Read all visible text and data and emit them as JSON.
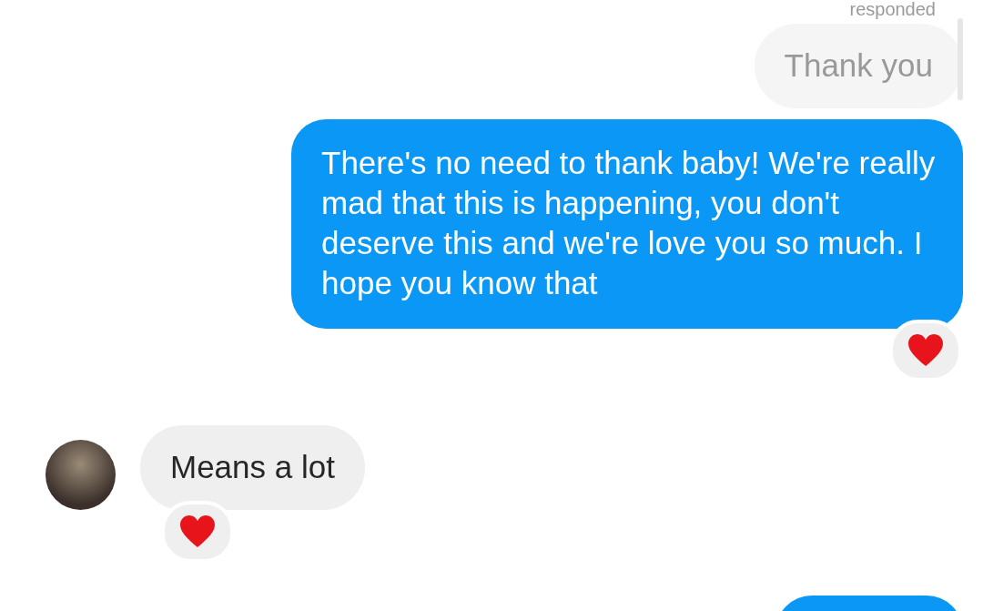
{
  "status_label": "responded",
  "messages": [
    {
      "kind": "faded",
      "text": "Thank you",
      "reacted": false
    },
    {
      "kind": "sent",
      "text": "There's no need to thank baby! We're really mad that this is happening, you don't deserve this and we're love you so much. I hope you know that",
      "reacted": true
    },
    {
      "kind": "received",
      "text": "Means a lot",
      "reacted": true
    },
    {
      "kind": "cut",
      "reacted": false
    }
  ]
}
